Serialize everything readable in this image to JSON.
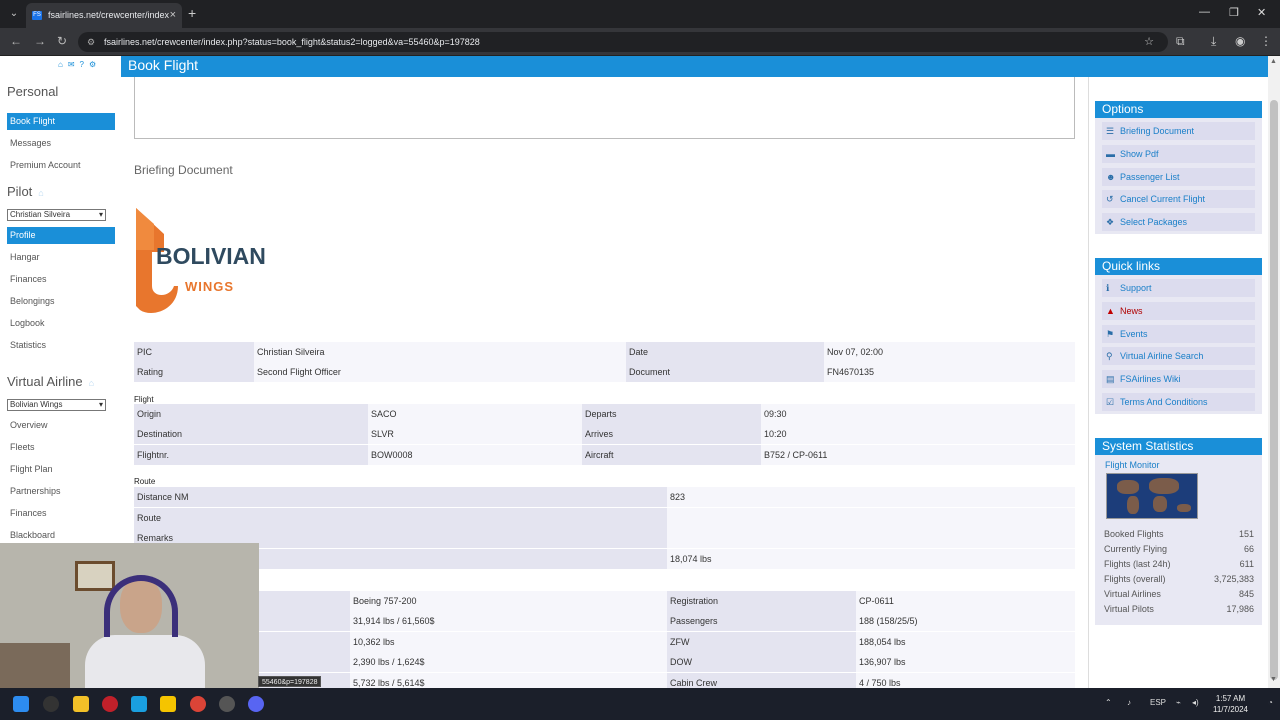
{
  "browser": {
    "tab_title": "fsairlines.net/crewcenter/index",
    "url": "fsairlines.net/crewcenter/index.php?status=book_flight&status2=logged&va=55460&p=197828",
    "favicon_text": "FS"
  },
  "page": {
    "header_title": "Book Flight",
    "briefing_title": "Briefing Document",
    "logo_word": "BOLIVIAN",
    "logo_sub": "WINGS"
  },
  "sidebar": {
    "personal_heading": "Personal",
    "personal_items": [
      "Book Flight",
      "Messages",
      "Premium Account"
    ],
    "pilot_heading": "Pilot",
    "pilot_select": "Christian Silveira",
    "pilot_items": [
      "Profile",
      "Hangar",
      "Finances",
      "Belongings",
      "Logbook",
      "Statistics"
    ],
    "va_heading": "Virtual Airline",
    "va_select": "Bolivian Wings",
    "va_items": [
      "Overview",
      "Fleets",
      "Flight Plan",
      "Partnerships",
      "Finances",
      "Blackboard"
    ]
  },
  "briefing": {
    "pic_label": "PIC",
    "pic": "Christian Silveira",
    "date_label": "Date",
    "date": "Nov 07, 02:00",
    "rating_label": "Rating",
    "rating": "Second Flight Officer",
    "document_label": "Document",
    "document": "FN4670135",
    "flight_section": "Flight",
    "origin_label": "Origin",
    "origin": "SACO",
    "departs_label": "Departs",
    "departs": "09:30",
    "destination_label": "Destination",
    "destination": "SLVR",
    "arrives_label": "Arrives",
    "arrives": "10:20",
    "flightnr_label": "Flightnr.",
    "flightnr": "BOW0008",
    "aircraft_label": "Aircraft",
    "aircraft": "B752 / CP-0611",
    "route_section": "Route",
    "distance_label": "Distance NM",
    "distance": "823",
    "route_label": "Route",
    "route": "",
    "remarks_label": "Remarks",
    "remarks": "",
    "fuel_value": "18,074 lbs",
    "ac_type": "Boeing 757-200",
    "registration_label": "Registration",
    "registration": "CP-0611",
    "payload": "31,914 lbs / 61,560$",
    "passengers_label": "Passengers",
    "passengers": "188 (158/25/5)",
    "cargo": "10,362 lbs",
    "zfw_label": "ZFW",
    "zfw": "188,054 lbs",
    "catering": "2,390 lbs / 1,624$",
    "dow_label": "DOW",
    "dow": "136,907 lbs",
    "misc": "5,732 lbs / 5,614$",
    "cabin_label": "Cabin Crew",
    "cabin": "4 / 750 lbs"
  },
  "options": {
    "heading": "Options",
    "items": [
      "Briefing Document",
      "Show Pdf",
      "Passenger List",
      "Cancel Current Flight",
      "Select Packages"
    ]
  },
  "quicklinks": {
    "heading": "Quick links",
    "items": [
      "Support",
      "News",
      "Events",
      "Virtual Airline Search",
      "FSAirlines Wiki",
      "Terms And Conditions"
    ]
  },
  "stats": {
    "heading": "System Statistics",
    "monitor": "Flight Monitor",
    "rows": [
      {
        "label": "Booked Flights",
        "value": "151"
      },
      {
        "label": "Currently Flying",
        "value": "66"
      },
      {
        "label": "Flights (last 24h)",
        "value": "611"
      },
      {
        "label": "Flights (overall)",
        "value": "3,725,383"
      },
      {
        "label": "Virtual Airlines",
        "value": "845"
      },
      {
        "label": "Virtual Pilots",
        "value": "17,986"
      }
    ]
  },
  "status_tooltip": "55460&p=197828",
  "taskbar": {
    "lang": "ESP",
    "time": "1:57 AM",
    "date": "11/7/2024"
  }
}
